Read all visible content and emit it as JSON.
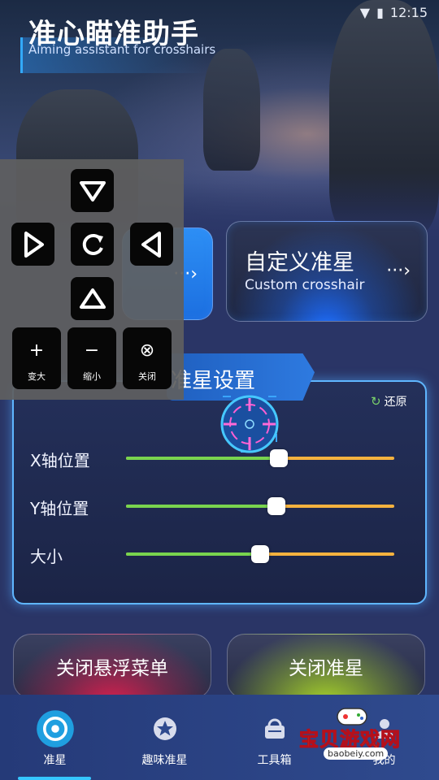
{
  "status_bar": {
    "time": "12:15"
  },
  "header": {
    "title": "准心瞄准助手",
    "subtitle": "Aiming assistant for crosshairs"
  },
  "mode_cards": {
    "custom": {
      "title": "自定义准星",
      "subtitle": "Custom crosshair",
      "arrow": "···›"
    },
    "default_arrow": "···›"
  },
  "settings": {
    "title": "准星设置",
    "reset_label": "还原",
    "sliders": [
      {
        "label": "X轴位置",
        "value_fraction": 0.57
      },
      {
        "label": "Y轴位置",
        "value_fraction": 0.56
      },
      {
        "label": "大小",
        "value_fraction": 0.5
      }
    ]
  },
  "actions": {
    "close_float_menu": "关闭悬浮菜单",
    "close_crosshair": "关闭准星"
  },
  "nav": {
    "items": [
      {
        "label": "准星",
        "icon": "crosshair-icon",
        "active": true
      },
      {
        "label": "趣味准星",
        "icon": "star-icon",
        "active": false
      },
      {
        "label": "工具箱",
        "icon": "toolbox-icon",
        "active": false
      },
      {
        "label": "我的",
        "icon": "user-icon",
        "active": false
      }
    ]
  },
  "watermark": {
    "text": "宝贝游戏网",
    "url": "baobeiy.com"
  },
  "overlay": {
    "enlarge": {
      "symbol": "+",
      "label": "变大"
    },
    "shrink": {
      "symbol": "−",
      "label": "缩小"
    },
    "close": {
      "symbol": "⊗",
      "label": "关闭"
    }
  },
  "colors": {
    "accent_blue": "#2d8ff5",
    "slider_green": "#79d44e",
    "slider_orange": "#f5b23e",
    "panel_border": "#5fb6ff"
  }
}
